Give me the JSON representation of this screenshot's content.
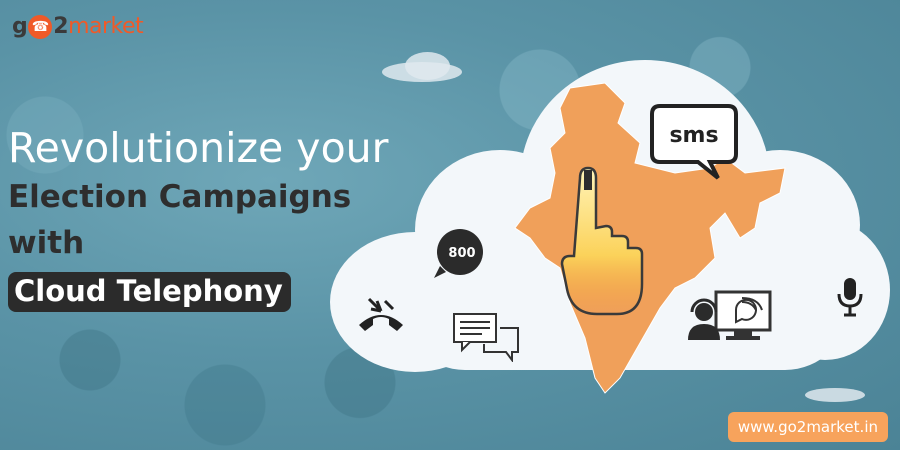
{
  "brand": {
    "logo_prefix": "g",
    "logo_o": "o",
    "logo_mid": "2",
    "logo_tail": "market"
  },
  "headline": {
    "line1": "Revolutionize your",
    "line2": "Election Campaigns",
    "line3": "with",
    "highlight": "Cloud Telephony"
  },
  "badges": {
    "sms": "sms",
    "tollfree": "800"
  },
  "website": "www.go2market.in",
  "colors": {
    "accent": "#f05a28",
    "map_orange": "#f0a05a",
    "cloud": "#f3f7fa",
    "pill_bg": "#2b2b2b",
    "web_bg": "#f7a35c"
  },
  "icons": [
    "phone-logo-icon",
    "sms-bubble-icon",
    "tollfree-phone-icon",
    "hangup-phone-icon",
    "chat-bubbles-icon",
    "agent-screen-icon",
    "microphone-icon",
    "voting-finger-icon",
    "india-map-icon"
  ]
}
